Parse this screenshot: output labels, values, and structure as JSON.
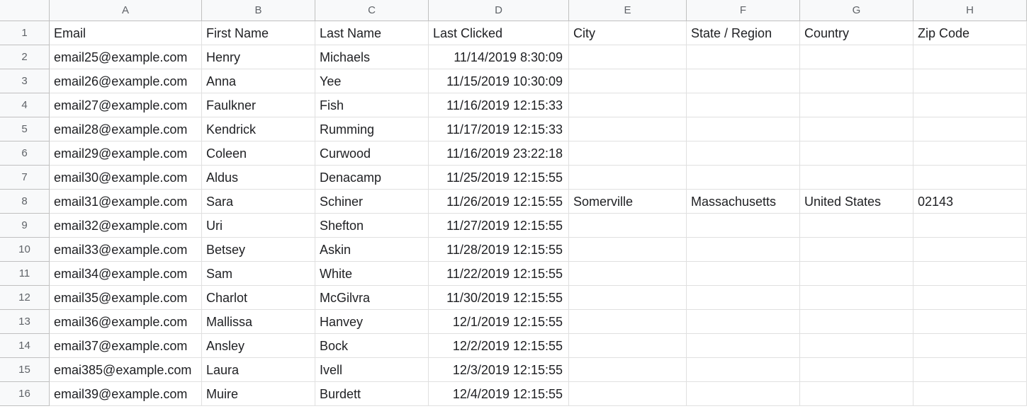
{
  "columns": [
    "A",
    "B",
    "C",
    "D",
    "E",
    "F",
    "G",
    "H"
  ],
  "rownums": [
    1,
    2,
    3,
    4,
    5,
    6,
    7,
    8,
    9,
    10,
    11,
    12,
    13,
    14,
    15,
    16
  ],
  "headers": {
    "email": "Email",
    "first": "First Name",
    "last": "Last Name",
    "clicked": "Last Clicked",
    "city": "City",
    "state": "State / Region",
    "country": "Country",
    "zip": "Zip Code"
  },
  "rows": [
    {
      "email": "email25@example.com",
      "first": "Henry",
      "last": "Michaels",
      "clicked": "11/14/2019 8:30:09",
      "city": "",
      "state": "",
      "country": "",
      "zip": ""
    },
    {
      "email": "email26@example.com",
      "first": "Anna",
      "last": "Yee",
      "clicked": "11/15/2019 10:30:09",
      "city": "",
      "state": "",
      "country": "",
      "zip": ""
    },
    {
      "email": "email27@example.com",
      "first": "Faulkner",
      "last": "Fish",
      "clicked": "11/16/2019 12:15:33",
      "city": "",
      "state": "",
      "country": "",
      "zip": ""
    },
    {
      "email": "email28@example.com",
      "first": "Kendrick",
      "last": "Rumming",
      "clicked": "11/17/2019 12:15:33",
      "city": "",
      "state": "",
      "country": "",
      "zip": ""
    },
    {
      "email": "email29@example.com",
      "first": "Coleen",
      "last": "Curwood",
      "clicked": "11/16/2019 23:22:18",
      "city": "",
      "state": "",
      "country": "",
      "zip": ""
    },
    {
      "email": "email30@example.com",
      "first": "Aldus",
      "last": "Denacamp",
      "clicked": "11/25/2019 12:15:55",
      "city": "",
      "state": "",
      "country": "",
      "zip": ""
    },
    {
      "email": "email31@example.com",
      "first": "Sara",
      "last": "Schiner",
      "clicked": "11/26/2019 12:15:55",
      "city": "Somerville",
      "state": "Massachusetts",
      "country": "United States",
      "zip": "02143"
    },
    {
      "email": "email32@example.com",
      "first": "Uri",
      "last": "Shefton",
      "clicked": "11/27/2019 12:15:55",
      "city": "",
      "state": "",
      "country": "",
      "zip": ""
    },
    {
      "email": "email33@example.com",
      "first": "Betsey",
      "last": "Askin",
      "clicked": "11/28/2019 12:15:55",
      "city": "",
      "state": "",
      "country": "",
      "zip": ""
    },
    {
      "email": "email34@example.com",
      "first": "Sam",
      "last": "White",
      "clicked": "11/22/2019 12:15:55",
      "city": "",
      "state": "",
      "country": "",
      "zip": ""
    },
    {
      "email": "email35@example.com",
      "first": "Charlot",
      "last": "McGilvra",
      "clicked": "11/30/2019 12:15:55",
      "city": "",
      "state": "",
      "country": "",
      "zip": ""
    },
    {
      "email": "email36@example.com",
      "first": "Mallissa",
      "last": "Hanvey",
      "clicked": "12/1/2019 12:15:55",
      "city": "",
      "state": "",
      "country": "",
      "zip": ""
    },
    {
      "email": "email37@example.com",
      "first": "Ansley",
      "last": "Bock",
      "clicked": "12/2/2019 12:15:55",
      "city": "",
      "state": "",
      "country": "",
      "zip": ""
    },
    {
      "email": "emai385@example.com",
      "first": "Laura",
      "last": "Ivell",
      "clicked": "12/3/2019 12:15:55",
      "city": "",
      "state": "",
      "country": "",
      "zip": ""
    },
    {
      "email": "email39@example.com",
      "first": "Muire",
      "last": "Burdett",
      "clicked": "12/4/2019 12:15:55",
      "city": "",
      "state": "",
      "country": "",
      "zip": ""
    }
  ]
}
